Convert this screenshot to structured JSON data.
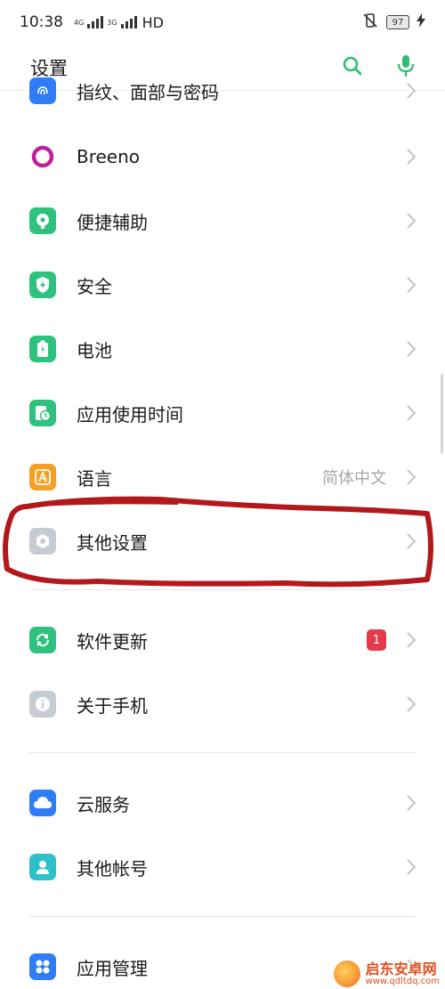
{
  "status_bar": {
    "time": "10:38",
    "network_1": "4G",
    "network_2": "3G",
    "hd": "HD",
    "battery": "97",
    "icons": [
      "signal-icon",
      "signal-icon",
      "mute-vibrate-icon",
      "battery-icon",
      "charging-icon"
    ]
  },
  "header": {
    "title": "设置",
    "search_icon": "search-icon",
    "voice_icon": "microphone-icon",
    "accent": "#2fbf71"
  },
  "items": [
    {
      "label": "指纹、面部与密码",
      "icon": "fingerprint-icon",
      "color": "#2f7cf6"
    },
    {
      "label": "Breeno",
      "icon": "breeno-icon",
      "color": "#ffffff"
    },
    {
      "label": "便捷辅助",
      "icon": "assist-icon",
      "color": "#2ec27e"
    },
    {
      "label": "安全",
      "icon": "shield-icon",
      "color": "#2ec27e"
    },
    {
      "label": "电池",
      "icon": "battery-icon",
      "color": "#2ec27e"
    },
    {
      "label": "应用使用时间",
      "icon": "timer-icon",
      "color": "#2ec27e"
    },
    {
      "label": "语言",
      "icon": "language-icon",
      "color": "#f5a023",
      "value": "简体中文"
    },
    {
      "label": "其他设置",
      "icon": "gear-icon",
      "color": "#c7cbd3"
    },
    {
      "label": "软件更新",
      "icon": "update-icon",
      "color": "#2ec27e",
      "badge": "1"
    },
    {
      "label": "关于手机",
      "icon": "info-icon",
      "color": "#c7cbd3"
    },
    {
      "label": "云服务",
      "icon": "cloud-icon",
      "color": "#2f7cf6"
    },
    {
      "label": "其他帐号",
      "icon": "account-icon",
      "color": "#2ec0c8"
    },
    {
      "label": "应用管理",
      "icon": "apps-icon",
      "color": "#2f7cf6"
    }
  ],
  "annotation_color": "#b3181b",
  "watermark": {
    "name": "启东安卓网",
    "url": "www.qdltdq.com"
  }
}
